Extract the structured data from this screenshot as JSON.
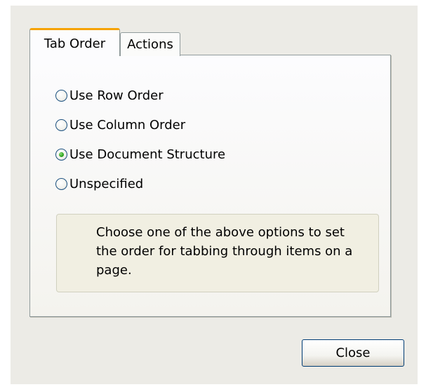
{
  "tabs": {
    "active_label": "Tab Order",
    "inactive_label": "Actions"
  },
  "options": [
    {
      "label": "Use Row Order",
      "selected": false
    },
    {
      "label": "Use Column Order",
      "selected": false
    },
    {
      "label": "Use Document Structure",
      "selected": true
    },
    {
      "label": "Unspecified",
      "selected": false
    }
  ],
  "help_text": "Choose one of the above options to set the order for tabbing through items on a page.",
  "close_label": "Close",
  "colors": {
    "dialog_background": "#ecebe6",
    "active_tab_accent": "#f6a300",
    "border": "#919b9c",
    "radio_selected": "#2fa31f",
    "button_border": "#003c74"
  }
}
